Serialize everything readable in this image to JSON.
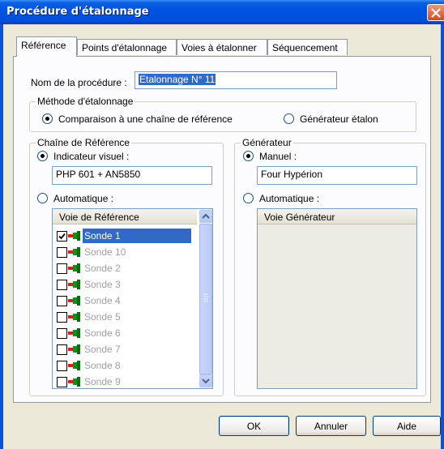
{
  "window": {
    "title": "Procédure d'étalonnage"
  },
  "tabs": [
    {
      "label": "Référence"
    },
    {
      "label": "Points d'étalonnage"
    },
    {
      "label": "Voies à étalonner"
    },
    {
      "label": "Séquencement"
    }
  ],
  "procedure": {
    "label": "Nom de la procédure :",
    "value": "Etalonnage N° 11"
  },
  "methode": {
    "title": "Méthode d'étalonnage",
    "option_comparaison": "Comparaison à une chaîne de référence",
    "option_generateur": "Générateur étalon",
    "selected": "comparaison"
  },
  "chaine": {
    "title": "Chaîne de Référence",
    "indicateur_label": "Indicateur visuel :",
    "indicateur_value": "PHP 601 + AN5850",
    "auto_label": "Automatique :",
    "list_header": "Voie de Référence",
    "items": [
      {
        "label": "Sonde 1",
        "checked": true,
        "selected": true
      },
      {
        "label": "Sonde 10",
        "checked": false
      },
      {
        "label": "Sonde 2",
        "checked": false
      },
      {
        "label": "Sonde 3",
        "checked": false
      },
      {
        "label": "Sonde 4",
        "checked": false
      },
      {
        "label": "Sonde 5",
        "checked": false
      },
      {
        "label": "Sonde 6",
        "checked": false
      },
      {
        "label": "Sonde 7",
        "checked": false
      },
      {
        "label": "Sonde 8",
        "checked": false
      },
      {
        "label": "Sonde 9",
        "checked": false
      }
    ]
  },
  "generateur": {
    "title": "Générateur",
    "manuel_label": "Manuel :",
    "manuel_value": "Four Hypérion",
    "auto_label": "Automatique :",
    "list_header": "Voie Générateur"
  },
  "buttons": {
    "ok": "OK",
    "annuler": "Annuler",
    "aide": "Aide"
  },
  "colors": {
    "titlebar": "#0054e3",
    "selection": "#316ac5",
    "plug_green": "#1a8a1a",
    "plug_red": "#d22020"
  },
  "icons": {
    "close": "close-icon",
    "plug": "plug-icon",
    "check": "checkmark-icon"
  }
}
